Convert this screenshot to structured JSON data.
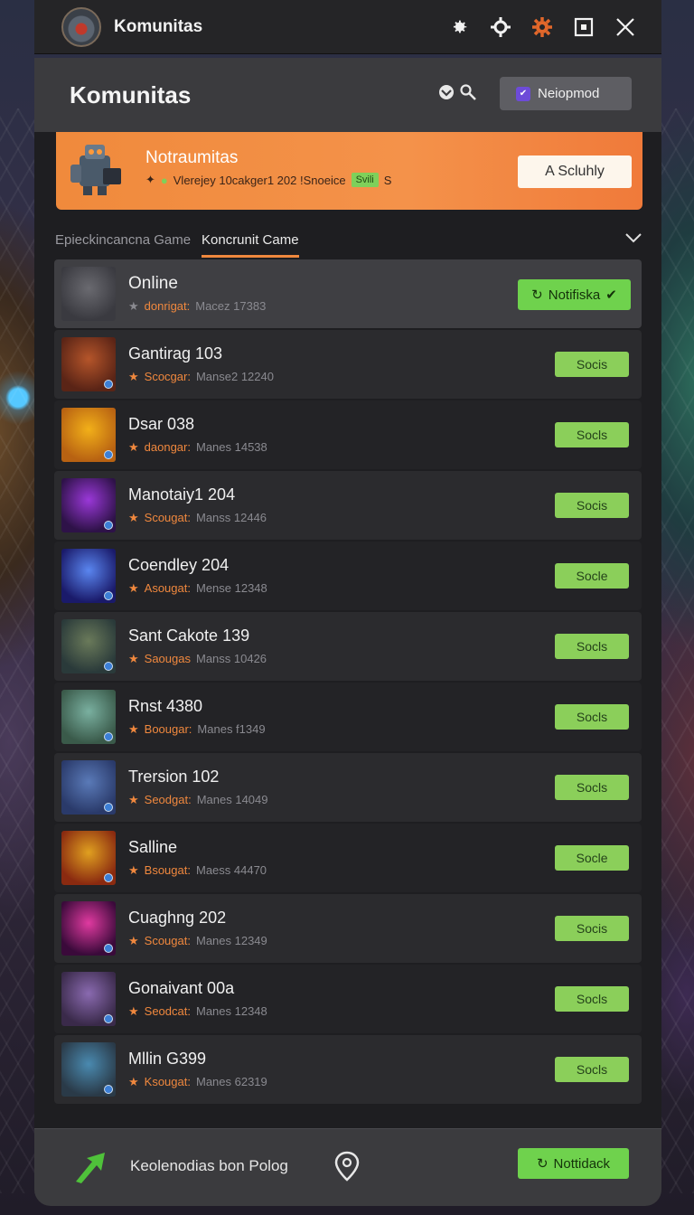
{
  "window": {
    "title": "Komunitas",
    "icons": [
      "gear-icon",
      "settings-cog-icon",
      "settings-cog-active-icon",
      "maximize-icon",
      "close-icon"
    ]
  },
  "header": {
    "title": "Komunitas",
    "profile_button_label": "Neiopmod",
    "icons": [
      "community-icon",
      "search-icon"
    ]
  },
  "banner": {
    "title": "Notraumitas",
    "subtitle": "Vlerejey 10cakger1 202 !Snoeice",
    "tag": "Svili",
    "tag_suffix": "S",
    "button_label": "A Scluhly"
  },
  "tabs": [
    {
      "label": "Epieckincancna Game",
      "active": false
    },
    {
      "label": "Koncrunit Came",
      "active": true
    }
  ],
  "games": [
    {
      "name": "Online",
      "rank": "donrigat:",
      "count": "Macez 17383",
      "button": "Notifiska",
      "featured": true,
      "colors": [
        "#6a6a70",
        "#3a3a40"
      ]
    },
    {
      "name": "Gantirag 103",
      "rank": "Scocgar:",
      "count": "Manse2 12240",
      "button": "Socis",
      "colors": [
        "#b5552a",
        "#5a2416"
      ]
    },
    {
      "name": "Dsar 038",
      "rank": "daongar:",
      "count": "Manes 14538",
      "button": "Socls",
      "colors": [
        "#f2b019",
        "#b86212"
      ]
    },
    {
      "name": "Manotaiy1 204",
      "rank": "Scougat:",
      "count": "Manss 12446",
      "button": "Socis",
      "colors": [
        "#9a38d8",
        "#2e1248"
      ]
    },
    {
      "name": "Coendley 204",
      "rank": "Asougat:",
      "count": "Mense 12348",
      "button": "Socle",
      "colors": [
        "#5a86f0",
        "#1a1a6a"
      ]
    },
    {
      "name": "Sant Cakote 139",
      "rank": "Saougas",
      "count": "Manss 10426",
      "button": "Socls",
      "colors": [
        "#6a7a5a",
        "#2a3a3a"
      ]
    },
    {
      "name": "Rnst 4380",
      "rank": "Boougar:",
      "count": "Manes f1349",
      "button": "Socls",
      "colors": [
        "#7ab0a0",
        "#3a5a4a"
      ]
    },
    {
      "name": "Trersion 102",
      "rank": "Seodgat:",
      "count": "Manes 14049",
      "button": "Socls",
      "colors": [
        "#5a7ab8",
        "#2a3a6a"
      ]
    },
    {
      "name": "Salline",
      "rank": "Bsougat:",
      "count": "Maess 44470",
      "button": "Socle",
      "colors": [
        "#e0a020",
        "#8a2a10"
      ]
    },
    {
      "name": "Cuaghng 202",
      "rank": "Scougat:",
      "count": "Manes 12349",
      "button": "Socis",
      "colors": [
        "#e03aa0",
        "#3a0a3a"
      ]
    },
    {
      "name": "Gonaivant 00a",
      "rank": "Seodcat:",
      "count": "Manes 12348",
      "button": "Socls",
      "colors": [
        "#8a6ab0",
        "#3a2a4a"
      ]
    },
    {
      "name": "Mllin G399",
      "rank": "Ksougat:",
      "count": "Manes 62319",
      "button": "Socls",
      "colors": [
        "#4a8ab0",
        "#2a3a48"
      ]
    }
  ],
  "bottom_bar": {
    "text": "Keolenodias bon Polog",
    "button_label": "Nottidack",
    "icons": [
      "arrow-icon",
      "location-pin-icon"
    ]
  },
  "colors": {
    "accent": "#f0883e",
    "green": "#8bcf5a",
    "green_bright": "#6fd24d",
    "panel": "#1e1e21"
  }
}
